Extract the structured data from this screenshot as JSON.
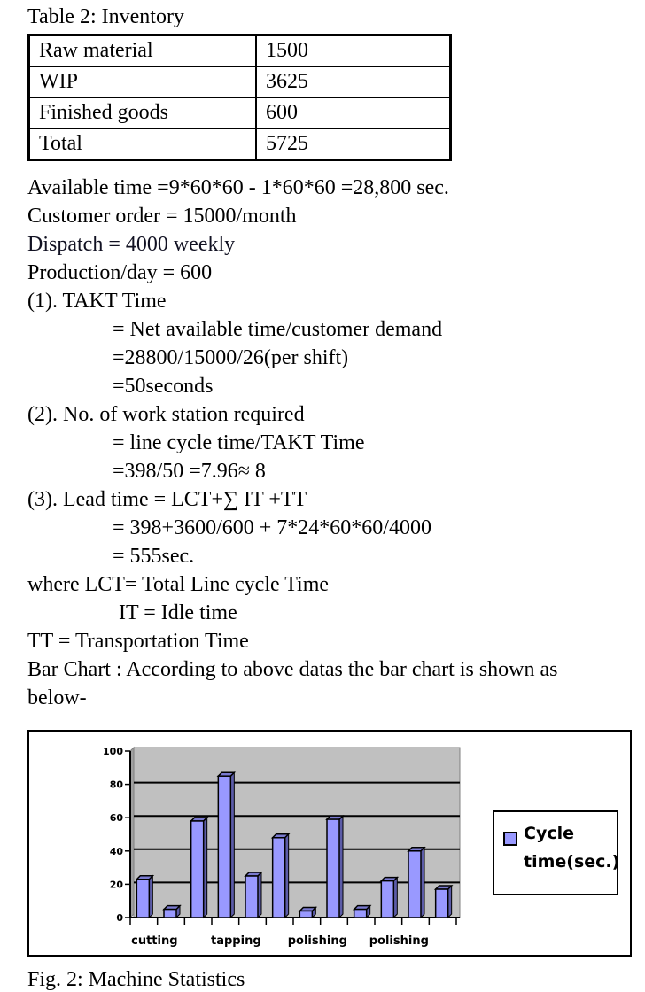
{
  "table": {
    "caption": "Table 2: Inventory",
    "rows": [
      [
        "Raw  material",
        "1500"
      ],
      [
        "WIP",
        "3625"
      ],
      [
        "Finished goods",
        "600"
      ],
      [
        "Total",
        "5725"
      ]
    ]
  },
  "text_lines": [
    "Available time =9*60*60 - 1*60*60 =28,800 sec.",
    "Customer order = 15000/month",
    "Dispatch = 4000 weekly",
    "Production/day = 600",
    "(1). TAKT Time",
    "= Net available time/customer demand",
    "=28800/15000/26(per shift)",
    "=50seconds",
    "(2). No. of work station required",
    "= line cycle time/TAKT Time",
    "=398/50 =7.96≈ 8",
    "(3). Lead time = LCT+∑ IT +TT",
    "= 398+3600/600 + 7*24*60*60/4000",
    "= 555sec.",
    "where LCT= Total Line cycle Time",
    "IT = Idle time",
    "TT = Transportation Time",
    "Bar Chart : According to above datas the bar chart is shown as",
    "below-"
  ],
  "figure_caption": "Fig. 2: Machine Statistics",
  "chart_data": {
    "type": "bar",
    "style": "3d-column",
    "title": "",
    "xlabel": "",
    "ylabel": "",
    "categories": [
      "cutting",
      "",
      "",
      "tapping",
      "",
      "",
      "polishing",
      "",
      "",
      "polishing",
      "",
      ""
    ],
    "series": [
      {
        "name": "Cycle time(sec.)",
        "color": "#9999ff",
        "values": [
          23,
          5,
          58,
          85,
          25,
          48,
          4,
          59,
          5,
          22,
          40,
          17
        ]
      }
    ],
    "ylim": [
      0,
      100
    ],
    "yticks": [
      0,
      20,
      40,
      60,
      80,
      100
    ],
    "grid": true,
    "plot_background": "#c0c0c0",
    "legend": {
      "position": "right",
      "label": "Cycle time(sec.)"
    }
  }
}
